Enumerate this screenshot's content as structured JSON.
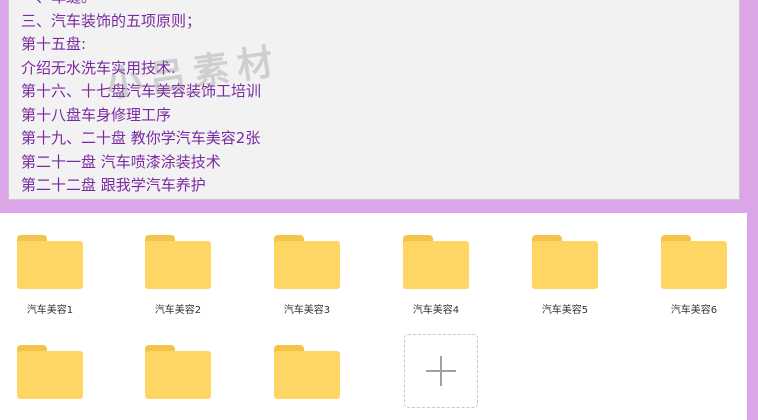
{
  "text_panel": {
    "lines": [
      "一、车缝。",
      "三、汽车装饰的五项原则；",
      "第十五盘:",
      "介绍无水洗车实用技术.",
      "第十六、十七盘汽车美容装饰工培训",
      "第十八盘车身修理工序",
      "第十九、二十盘 教你学汽车美容2张",
      "第二十一盘 汽车喷漆涂装技术",
      "第二十二盘 跟我学汽车养护"
    ],
    "watermark": "小吕素材"
  },
  "folders": [
    {
      "label": "汽车美容1"
    },
    {
      "label": "汽车美容2"
    },
    {
      "label": "汽车美容3"
    },
    {
      "label": "汽车美容4"
    },
    {
      "label": "汽车美容5"
    },
    {
      "label": "汽车美容6"
    },
    {
      "label": ""
    },
    {
      "label": ""
    },
    {
      "label": ""
    }
  ],
  "colors": {
    "frame": "#dca5e8",
    "text": "#7a2aa0",
    "folder": "#ffd663",
    "folder_tab": "#f3c447"
  }
}
